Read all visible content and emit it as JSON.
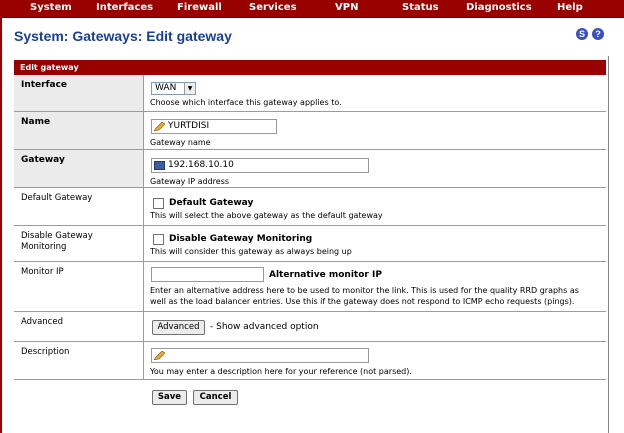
{
  "nav": {
    "items": [
      "System",
      "Interfaces",
      "Firewall",
      "Services",
      "VPN",
      "Status",
      "Diagnostics",
      "Help"
    ]
  },
  "page": {
    "title": "System: Gateways: Edit gateway",
    "section_title": "Edit gateway"
  },
  "form": {
    "interface": {
      "label": "Interface",
      "value": "WAN",
      "help": "Choose which interface this gateway applies to."
    },
    "name": {
      "label": "Name",
      "value": "YURTDISI",
      "help": "Gateway name"
    },
    "gateway": {
      "label": "Gateway",
      "value": "192.168.10.10",
      "help": "Gateway IP address"
    },
    "default_gateway": {
      "label": "Default Gateway",
      "checkbox_label": "Default Gateway",
      "checked": false,
      "help": "This will select the above gateway as the default gateway"
    },
    "disable_monitoring": {
      "label_line1": "Disable Gateway",
      "label_line2": "Monitoring",
      "checkbox_label": "Disable Gateway Monitoring",
      "checked": false,
      "help": "This will consider this gateway as always being up"
    },
    "monitor_ip": {
      "label": "Monitor IP",
      "value": "",
      "inline_label": "Alternative monitor IP",
      "help_line1": "Enter an alternative address here to be used to monitor the link. This is used for the quality RRD graphs as",
      "help_line2": "well as the load balancer entries. Use this if the gateway does not respond to ICMP echo requests (pings)."
    },
    "advanced": {
      "label": "Advanced",
      "button": "Advanced",
      "help": "- Show advanced option"
    },
    "description": {
      "label": "Description",
      "value": "",
      "help": "You may enter a description here for your reference (not parsed)."
    }
  },
  "actions": {
    "save": "Save",
    "cancel": "Cancel"
  },
  "colors": {
    "brand": "#990000",
    "title": "#1a3f96"
  }
}
